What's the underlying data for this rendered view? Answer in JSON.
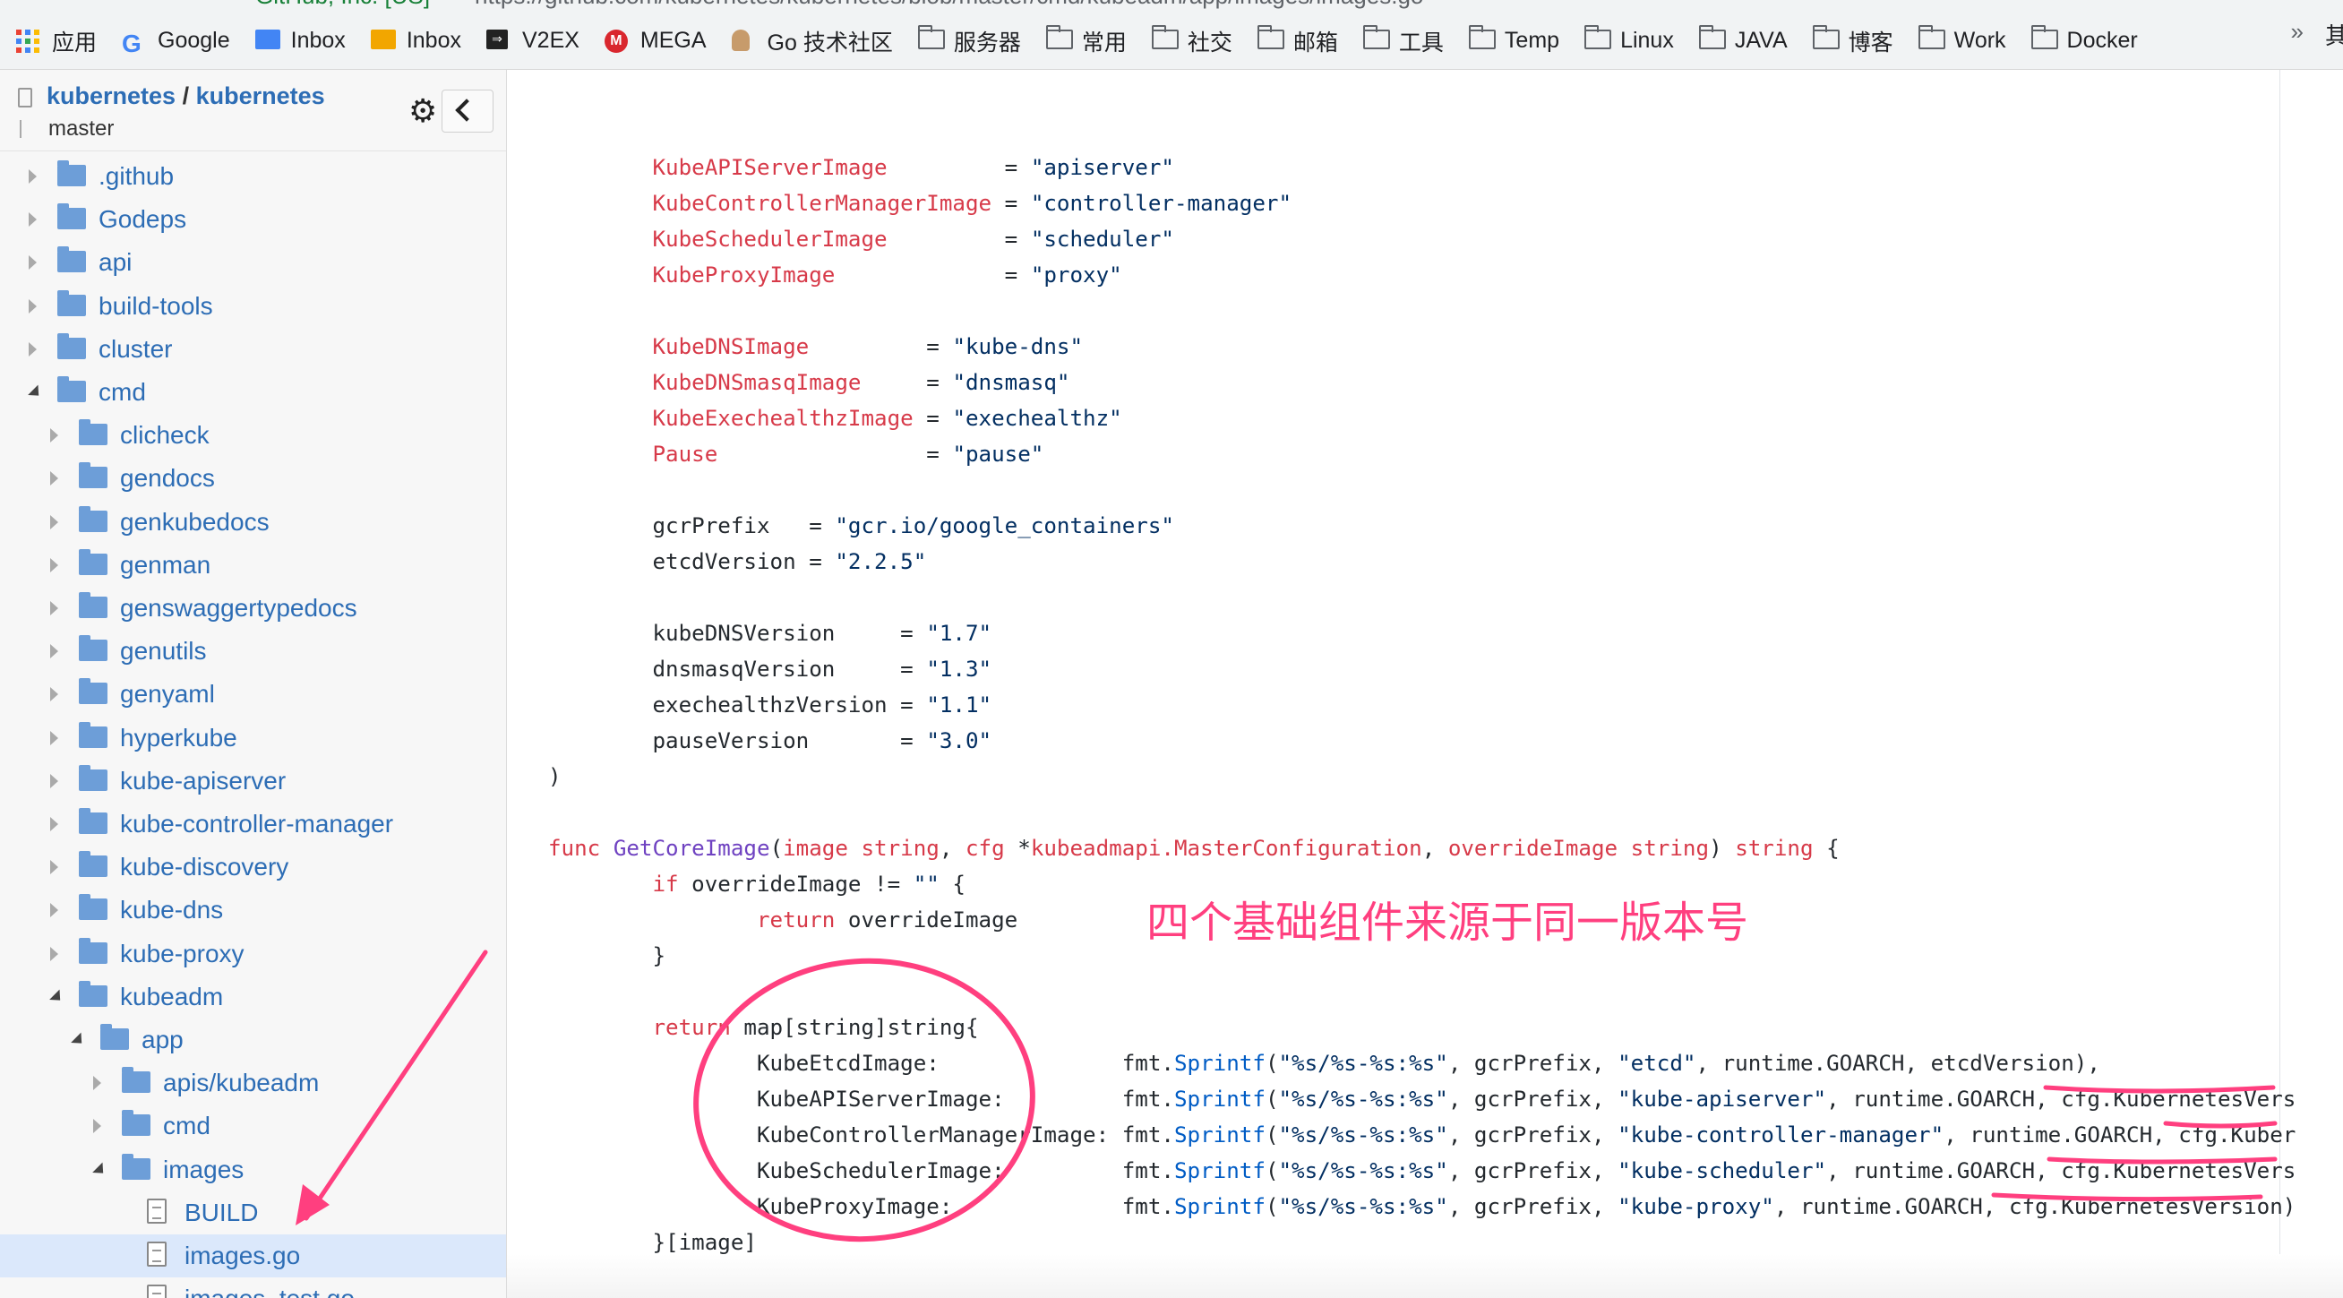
{
  "browser": {
    "site_label": "GitHub, Inc. [US]",
    "url": "https://github.com/kubernetes/kubernetes/blob/master/cmd/kubeadm/app/images/images.go"
  },
  "bookmarks": [
    {
      "label": "应用",
      "icon": "apps-grid-icon"
    },
    {
      "label": "Google",
      "icon": "google-icon"
    },
    {
      "label": "Inbox",
      "icon": "inbox-blue-icon"
    },
    {
      "label": "Inbox",
      "icon": "inbox-yellow-icon"
    },
    {
      "label": "V2EX",
      "icon": "v2ex-icon"
    },
    {
      "label": "MEGA",
      "icon": "mega-icon"
    },
    {
      "label": "Go 技术社区",
      "icon": "gopher-icon"
    },
    {
      "label": "服务器",
      "icon": "folder-icon"
    },
    {
      "label": "常用",
      "icon": "folder-icon"
    },
    {
      "label": "社交",
      "icon": "folder-icon"
    },
    {
      "label": "邮箱",
      "icon": "folder-icon"
    },
    {
      "label": "工具",
      "icon": "folder-icon"
    },
    {
      "label": "Temp",
      "icon": "folder-icon"
    },
    {
      "label": "Linux",
      "icon": "folder-icon"
    },
    {
      "label": "JAVA",
      "icon": "folder-icon"
    },
    {
      "label": "博客",
      "icon": "folder-icon"
    },
    {
      "label": "Work",
      "icon": "folder-icon"
    },
    {
      "label": "Docker",
      "icon": "folder-icon"
    }
  ],
  "bookmarks_more": "»",
  "bookmarks_cut": "其",
  "sidebar": {
    "owner": "kubernetes",
    "separator": " / ",
    "repo": "kubernetes",
    "branch": "master",
    "gear_glyph": "⚙",
    "tree": [
      {
        "label": ".github",
        "type": "folder",
        "depth": 0,
        "expanded": false
      },
      {
        "label": "Godeps",
        "type": "folder",
        "depth": 0,
        "expanded": false
      },
      {
        "label": "api",
        "type": "folder",
        "depth": 0,
        "expanded": false
      },
      {
        "label": "build-tools",
        "type": "folder",
        "depth": 0,
        "expanded": false
      },
      {
        "label": "cluster",
        "type": "folder",
        "depth": 0,
        "expanded": false
      },
      {
        "label": "cmd",
        "type": "folder",
        "depth": 0,
        "expanded": true
      },
      {
        "label": "clicheck",
        "type": "folder",
        "depth": 1,
        "expanded": false
      },
      {
        "label": "gendocs",
        "type": "folder",
        "depth": 1,
        "expanded": false
      },
      {
        "label": "genkubedocs",
        "type": "folder",
        "depth": 1,
        "expanded": false
      },
      {
        "label": "genman",
        "type": "folder",
        "depth": 1,
        "expanded": false
      },
      {
        "label": "genswaggertypedocs",
        "type": "folder",
        "depth": 1,
        "expanded": false
      },
      {
        "label": "genutils",
        "type": "folder",
        "depth": 1,
        "expanded": false
      },
      {
        "label": "genyaml",
        "type": "folder",
        "depth": 1,
        "expanded": false
      },
      {
        "label": "hyperkube",
        "type": "folder",
        "depth": 1,
        "expanded": false
      },
      {
        "label": "kube-apiserver",
        "type": "folder",
        "depth": 1,
        "expanded": false
      },
      {
        "label": "kube-controller-manager",
        "type": "folder",
        "depth": 1,
        "expanded": false
      },
      {
        "label": "kube-discovery",
        "type": "folder",
        "depth": 1,
        "expanded": false
      },
      {
        "label": "kube-dns",
        "type": "folder",
        "depth": 1,
        "expanded": false
      },
      {
        "label": "kube-proxy",
        "type": "folder",
        "depth": 1,
        "expanded": false
      },
      {
        "label": "kubeadm",
        "type": "folder",
        "depth": 1,
        "expanded": true
      },
      {
        "label": "app",
        "type": "folder",
        "depth": 2,
        "expanded": true
      },
      {
        "label": "apis/kubeadm",
        "type": "folder",
        "depth": 3,
        "expanded": false
      },
      {
        "label": "cmd",
        "type": "folder",
        "depth": 3,
        "expanded": false
      },
      {
        "label": "images",
        "type": "folder",
        "depth": 3,
        "expanded": true
      },
      {
        "label": "BUILD",
        "type": "file",
        "depth": 4
      },
      {
        "label": "images.go",
        "type": "file",
        "depth": 4,
        "selected": true
      },
      {
        "label": "images_test.go",
        "type": "file",
        "depth": 4
      }
    ]
  },
  "code_lines": [
    [],
    [
      [
        "\t",
        "c"
      ],
      [
        "KubeAPIServerImage",
        "k"
      ],
      [
        "         = ",
        "c"
      ],
      [
        "\"apiserver\"",
        "s"
      ]
    ],
    [
      [
        "\t",
        "c"
      ],
      [
        "KubeControllerManagerImage",
        "k"
      ],
      [
        " = ",
        "c"
      ],
      [
        "\"controller-manager\"",
        "s"
      ]
    ],
    [
      [
        "\t",
        "c"
      ],
      [
        "KubeSchedulerImage",
        "k"
      ],
      [
        "         = ",
        "c"
      ],
      [
        "\"scheduler\"",
        "s"
      ]
    ],
    [
      [
        "\t",
        "c"
      ],
      [
        "KubeProxyImage",
        "k"
      ],
      [
        "             = ",
        "c"
      ],
      [
        "\"proxy\"",
        "s"
      ]
    ],
    [],
    [
      [
        "\t",
        "c"
      ],
      [
        "KubeDNSImage",
        "k"
      ],
      [
        "         = ",
        "c"
      ],
      [
        "\"kube-dns\"",
        "s"
      ]
    ],
    [
      [
        "\t",
        "c"
      ],
      [
        "KubeDNSmasqImage",
        "k"
      ],
      [
        "     = ",
        "c"
      ],
      [
        "\"dnsmasq\"",
        "s"
      ]
    ],
    [
      [
        "\t",
        "c"
      ],
      [
        "KubeExechealthzImage",
        "k"
      ],
      [
        " = ",
        "c"
      ],
      [
        "\"exechealthz\"",
        "s"
      ]
    ],
    [
      [
        "\t",
        "c"
      ],
      [
        "Pause",
        "k"
      ],
      [
        "                = ",
        "c"
      ],
      [
        "\"pause\"",
        "s"
      ]
    ],
    [],
    [
      [
        "\tgcrPrefix   = ",
        "c"
      ],
      [
        "\"gcr.io/google_containers\"",
        "s"
      ]
    ],
    [
      [
        "\tetcdVersion = ",
        "c"
      ],
      [
        "\"2.2.5\"",
        "s"
      ]
    ],
    [],
    [
      [
        "\tkubeDNSVersion     = ",
        "c"
      ],
      [
        "\"1.7\"",
        "s"
      ]
    ],
    [
      [
        "\tdnsmasqVersion     = ",
        "c"
      ],
      [
        "\"1.3\"",
        "s"
      ]
    ],
    [
      [
        "\texechealthzVersion = ",
        "c"
      ],
      [
        "\"1.1\"",
        "s"
      ]
    ],
    [
      [
        "\tpauseVersion       = ",
        "c"
      ],
      [
        "\"3.0\"",
        "s"
      ]
    ],
    [
      [
        ")",
        "c"
      ]
    ],
    [],
    [
      [
        "func ",
        "k"
      ],
      [
        "GetCoreImage",
        "f"
      ],
      [
        "(",
        "c"
      ],
      [
        "image string",
        "k"
      ],
      [
        ", ",
        "c"
      ],
      [
        "cfg ",
        "k"
      ],
      [
        "*",
        "c"
      ],
      [
        "kubeadmapi.MasterConfiguration",
        "k"
      ],
      [
        ", ",
        "c"
      ],
      [
        "overrideImage string",
        "k"
      ],
      [
        ") ",
        "c"
      ],
      [
        "string",
        "k"
      ],
      [
        " {",
        "c"
      ]
    ],
    [
      [
        "\t",
        "c"
      ],
      [
        "if",
        "k"
      ],
      [
        " overrideImage != ",
        "c"
      ],
      [
        "\"\"",
        "s"
      ],
      [
        " {",
        "c"
      ]
    ],
    [
      [
        "\t\t",
        "c"
      ],
      [
        "return",
        "k"
      ],
      [
        " overrideImage",
        "c"
      ]
    ],
    [
      [
        "\t}",
        "c"
      ]
    ],
    [],
    [
      [
        "\t",
        "c"
      ],
      [
        "return",
        "k"
      ],
      [
        " map[string]string{",
        "c"
      ]
    ],
    [
      [
        "\t\tKubeEtcdImage:              fmt.",
        "c"
      ],
      [
        "Sprintf",
        "fn"
      ],
      [
        "(",
        "c"
      ],
      [
        "\"%s/%s-%s:%s\"",
        "s"
      ],
      [
        ", gcrPrefix, ",
        "c"
      ],
      [
        "\"etcd\"",
        "s"
      ],
      [
        ", runtime.GOARCH, etcdVersion),",
        "c"
      ]
    ],
    [
      [
        "\t\tKubeAPIServerImage:         fmt.",
        "c"
      ],
      [
        "Sprintf",
        "fn"
      ],
      [
        "(",
        "c"
      ],
      [
        "\"%s/%s-%s:%s\"",
        "s"
      ],
      [
        ", gcrPrefix, ",
        "c"
      ],
      [
        "\"kube-apiserver\"",
        "s"
      ],
      [
        ", runtime.GOARCH, cfg.KubernetesVers",
        "c"
      ]
    ],
    [
      [
        "\t\tKubeControllerManagerImage: fmt.",
        "c"
      ],
      [
        "Sprintf",
        "fn"
      ],
      [
        "(",
        "c"
      ],
      [
        "\"%s/%s-%s:%s\"",
        "s"
      ],
      [
        ", gcrPrefix, ",
        "c"
      ],
      [
        "\"kube-controller-manager\"",
        "s"
      ],
      [
        ", runtime.GOARCH, cfg.Kuber",
        "c"
      ]
    ],
    [
      [
        "\t\tKubeSchedulerImage:         fmt.",
        "c"
      ],
      [
        "Sprintf",
        "fn"
      ],
      [
        "(",
        "c"
      ],
      [
        "\"%s/%s-%s:%s\"",
        "s"
      ],
      [
        ", gcrPrefix, ",
        "c"
      ],
      [
        "\"kube-scheduler\"",
        "s"
      ],
      [
        ", runtime.GOARCH, cfg.KubernetesVers",
        "c"
      ]
    ],
    [
      [
        "\t\tKubeProxyImage:             fmt.",
        "c"
      ],
      [
        "Sprintf",
        "fn"
      ],
      [
        "(",
        "c"
      ],
      [
        "\"%s/%s-%s:%s\"",
        "s"
      ],
      [
        ", gcrPrefix, ",
        "c"
      ],
      [
        "\"kube-proxy\"",
        "s"
      ],
      [
        ", runtime.GOARCH, cfg.KubernetesVersion)",
        "c"
      ]
    ],
    [
      [
        "\t}[image]",
        "c"
      ]
    ],
    [
      [
        "}",
        "c"
      ]
    ]
  ],
  "annotation": {
    "text": "四个基础组件来源于同一版本号",
    "color": "#ff3f7f"
  },
  "colors": {
    "link": "#2d6db5",
    "keyword": "#d73a49",
    "string": "#032f62",
    "selected_row": "#dbe8fb"
  }
}
